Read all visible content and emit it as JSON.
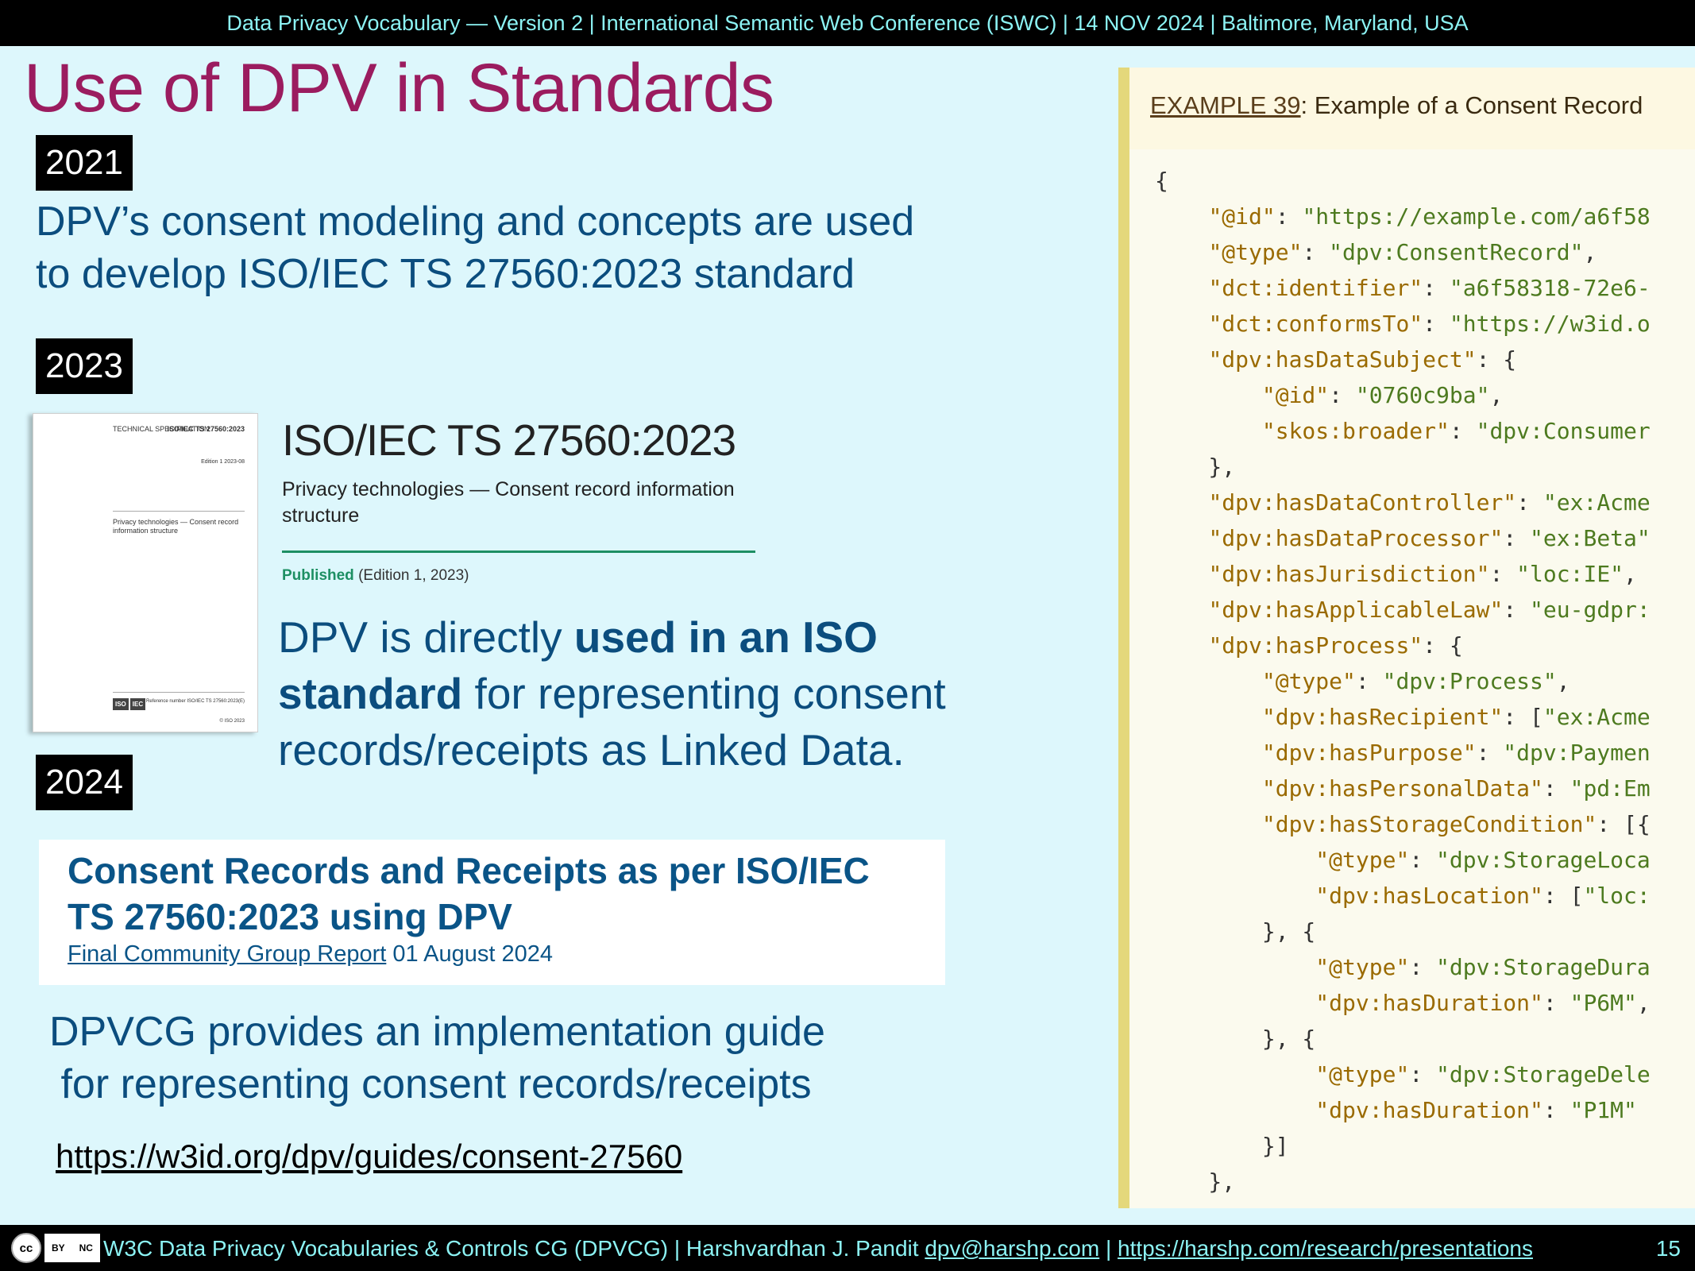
{
  "header": {
    "text": "Data Privacy Vocabulary — Version 2 | International Semantic Web Conference (ISWC) | 14 NOV 2024 | Baltimore, Maryland, USA"
  },
  "slide": {
    "title": "Use of DPV in Standards",
    "year_2021": "2021",
    "year_2023": "2023",
    "year_2024": "2024",
    "text_2021_line1": "DPV’s consent modeling and concepts are used",
    "text_2021_line2": "to develop ISO/IEC TS 27560:2023 standard",
    "iso_doc": {
      "thumb_type": "TECHNICAL SPECIFICATION",
      "thumb_ref": "ISO/IEC TS 27560:2023",
      "thumb_edition": "Edition 1 2023-08",
      "thumb_title": "Privacy technologies — Consent record information structure",
      "thumb_refnum": "Reference number ISO/IEC TS 27560:2023(E)",
      "thumb_copy": "© ISO 2023",
      "thumb_logo_iso": "ISO",
      "thumb_logo_iec": "IEC",
      "code": "ISO/IEC TS 27560:2023",
      "subtitle": "Privacy technologies — Consent record information structure",
      "published": "Published",
      "edition": "(Edition 1, 2023)"
    },
    "text_2023": {
      "l1_plain": "DPV is directly ",
      "l1_bold": "used in an ISO",
      "l2_bold": "standard",
      "l2_plain": " for representing consent",
      "l3": "records/receipts as Linked Data."
    },
    "report": {
      "title_line1": "Consent Records and Receipts as per ISO/IEC",
      "title_line2": "TS 27560:2023 using DPV",
      "status_link": "Final Community Group Report",
      "date": " 01 August 2024"
    },
    "text_2024_line1": "DPVCG provides an implementation guide",
    "text_2024_line2": " for representing consent records/receipts",
    "url": "https://w3id.org/dpv/guides/consent-27560"
  },
  "example": {
    "label": "EXAMPLE 39",
    "title": ": Example of a Consent Record",
    "code_lines": [
      "{",
      "    \"@id\": \"https://example.com/a6f58",
      "    \"@type\": \"dpv:ConsentRecord\",",
      "    \"dct:identifier\": \"a6f58318-72e6-",
      "    \"dct:conformsTo\": \"https://w3id.o",
      "    \"dpv:hasDataSubject\": {",
      "        \"@id\": \"0760c9ba\",",
      "        \"skos:broader\": \"dpv:Consumer",
      "    },",
      "    \"dpv:hasDataController\": \"ex:Acme",
      "    \"dpv:hasDataProcessor\": \"ex:Beta\"",
      "    \"dpv:hasJurisdiction\": \"loc:IE\",",
      "    \"dpv:hasApplicableLaw\": \"eu-gdpr:",
      "    \"dpv:hasProcess\": {",
      "        \"@type\": \"dpv:Process\",",
      "        \"dpv:hasRecipient\": [\"ex:Acme",
      "        \"dpv:hasPurpose\": \"dpv:Paymen",
      "        \"dpv:hasPersonalData\": \"pd:Em",
      "        \"dpv:hasStorageCondition\": [{",
      "            \"@type\": \"dpv:StorageLoca",
      "            \"dpv:hasLocation\": [\"loc:",
      "        }, {",
      "            \"@type\": \"dpv:StorageDura",
      "            \"dpv:hasDuration\": \"P6M\",",
      "        }, {",
      "            \"@type\": \"dpv:StorageDele",
      "            \"dpv:hasDuration\": \"P1M\"",
      "        }]",
      "    },"
    ]
  },
  "footer": {
    "license_cc": "cc",
    "license_by": "BY",
    "license_nc": "NC",
    "text": "W3C Data Privacy Vocabularies & Controls CG (DPVCG) | Harshvardhan J. Pandit ",
    "email": "dpv@harshp.com",
    "sep": " | ",
    "link": "https://harshp.com/research/presentations",
    "page_number": "15"
  }
}
